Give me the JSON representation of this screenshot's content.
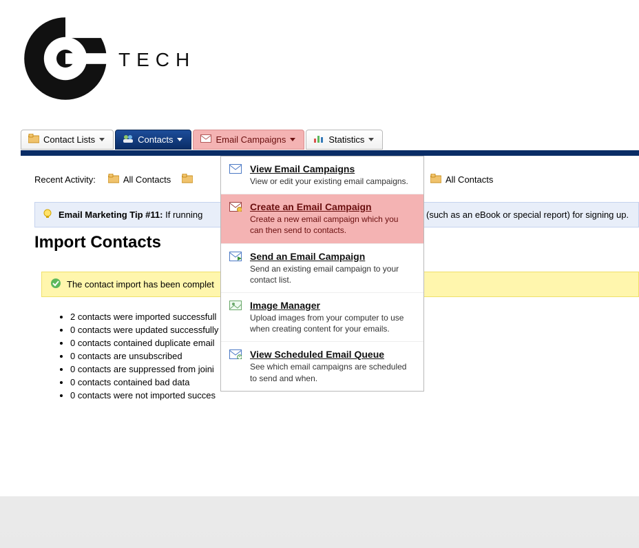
{
  "logo": {
    "text": "TECH"
  },
  "nav": {
    "contact_lists": "Contact Lists",
    "contacts": "Contacts",
    "email_campaigns": "Email Campaigns",
    "statistics": "Statistics"
  },
  "dropdown": {
    "view": {
      "title": "View Email Campaigns",
      "desc": "View or edit your existing email campaigns."
    },
    "create": {
      "title": "Create an Email Campaign",
      "desc": "Create a new email campaign which you can then send to contacts."
    },
    "send": {
      "title": "Send an Email Campaign",
      "desc": "Send an existing email campaign to your contact list."
    },
    "images": {
      "title": "Image Manager",
      "desc": "Upload images from your computer to use when creating content for your emails."
    },
    "queue": {
      "title": "View Scheduled Email Queue",
      "desc": "See which email campaigns are scheduled to send and when."
    }
  },
  "recent": {
    "label": "Recent Activity:",
    "all_contacts": "All Contacts"
  },
  "tip": {
    "label": "Email Marketing Tip #11:",
    "text_left": "If running",
    "text_right": "(such as an eBook or special report) for signing up."
  },
  "heading": "Import Contacts",
  "success": "The contact import has been complet",
  "bullets": [
    "2 contacts were imported successfull",
    "0 contacts were updated successfully",
    "0 contacts contained duplicate email",
    "0 contacts are unsubscribed",
    "0 contacts are suppressed from joini",
    "0 contacts contained bad data",
    "0 contacts were not imported succes"
  ]
}
